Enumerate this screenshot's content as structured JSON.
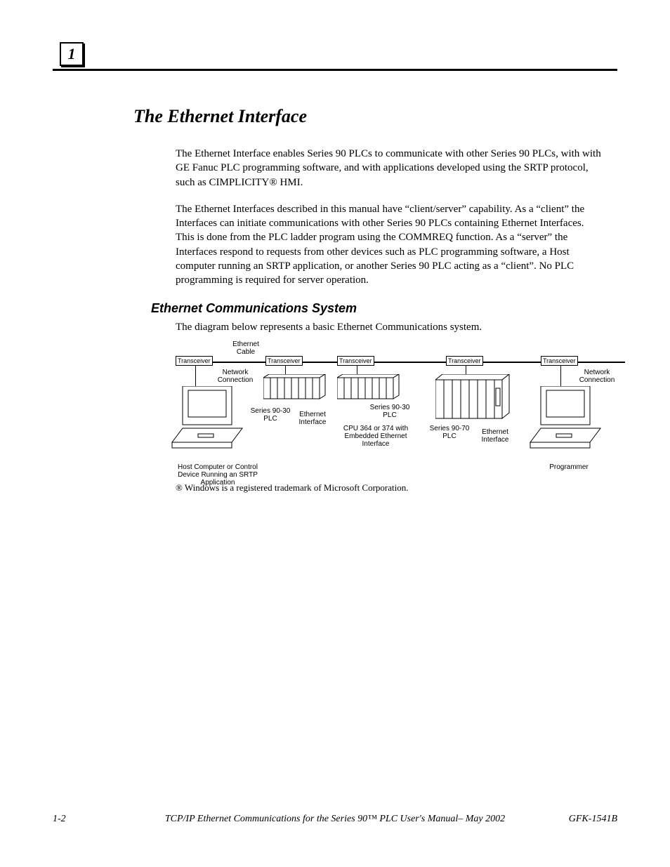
{
  "chapter": {
    "number": "1"
  },
  "section": {
    "title": "The Ethernet Interface"
  },
  "paragraphs": {
    "p1": "The Ethernet Interface enables Series 90 PLCs to communicate with other Series 90 PLCs, with with GE Fanuc PLC programming software, and with applications developed using the SRTP protocol, such as CIMPLICITY® HMI.",
    "p2": "The Ethernet Interfaces described in this manual have “client/server” capability.  As a “client” the Interfaces can initiate communications with other Series 90 PLCs containing Ethernet Interfaces.  This is done from the PLC ladder program using the COMMREQ function.  As a “server” the Interfaces respond to requests from other devices such as PLC programming software, a Host computer running an SRTP  application, or another Series 90 PLC acting as a “client”.  No PLC programming is required for server operation."
  },
  "subsection": {
    "title": "Ethernet Communications System",
    "intro": "The diagram below represents a basic Ethernet Communications system."
  },
  "diagram": {
    "cable_label": "Ethernet Cable",
    "transceiver": "Transceiver",
    "network_connection": "Network Connection",
    "host_caption": "Host Computer or Control Device Running an SRTP Application",
    "programmer_caption": "Programmer",
    "plc9030": "Series 90-30 PLC",
    "eth_iface": "Ethernet Interface",
    "cpu364": "CPU 364 or 374 with Embedded Ethernet Interface",
    "plc9070": "Series 90-70 PLC"
  },
  "footnote": "® Windows is a registered trademark of Microsoft Corporation.",
  "footer": {
    "page": "1-2",
    "title": "TCP/IP Ethernet Communications for the Series 90™ PLC User's Manual– May 2002",
    "docnum": "GFK-1541B"
  }
}
